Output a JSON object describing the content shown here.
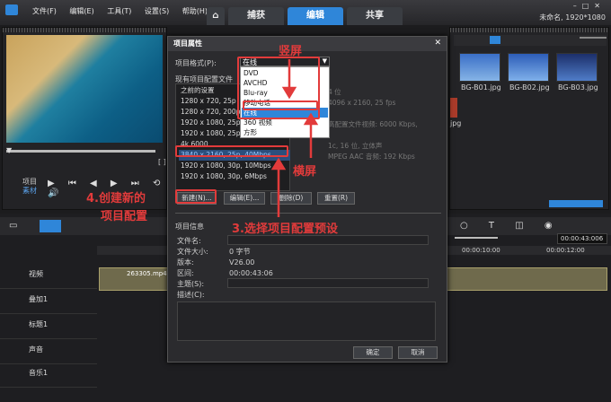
{
  "app": {
    "tabs": [
      "捕获",
      "编辑",
      "共享"
    ],
    "active_tab": "编辑",
    "status_right": "未命名, 1920*1080"
  },
  "menu": [
    "文件(F)",
    "编辑(E)",
    "工具(T)",
    "设置(S)",
    "帮助(H)"
  ],
  "library": {
    "thumbs": [
      "BG-B01.jpg",
      "BG-B02.jpg",
      "BG-B03.jpg"
    ],
    "extra_label": "jpg"
  },
  "dialog": {
    "title": "项目属性",
    "format_label": "项目格式(P):",
    "format_value": "在线",
    "format_options": [
      "DVD",
      "AVCHD",
      "Blu-ray",
      "移动电话",
      "在线",
      "360 视频",
      "方形"
    ],
    "format_selected": "在线",
    "profiles_label": "现有项目配置文件",
    "profiles": [
      "之前的设置",
      "1280 x 720, 25p",
      "1280 x 720, 200p",
      "1920 x 1080, 25p",
      "1920 x 1080, 25p",
      "4k 6000",
      "3840 x 2160, 25p, 40Mbps",
      "1920 x 1080, 30p, 10Mbps",
      "1920 x 1080, 30p, 6Mbps"
    ],
    "profile_selected_index": 6,
    "buttons": {
      "new": "新建(N)...",
      "edit": "编辑(E)...",
      "delete": "删除(D)",
      "reset": "重置(R)"
    },
    "info_header": "项目信息",
    "info": [
      {
        "k": "文件名:",
        "v": ""
      },
      {
        "k": "文件大小:",
        "v": "0 字节"
      },
      {
        "k": "版本:",
        "v": "V26.00"
      },
      {
        "k": "区间:",
        "v": "00:00:43:06"
      },
      {
        "k": "主题(S):",
        "v": ""
      },
      {
        "k": "描述(C):",
        "v": ""
      }
    ],
    "ok": "确定",
    "cancel": "取消",
    "behind_text": [
      "4 位",
      "4096 x 2160, 25 fps",
      "高配置文件视频: 6000 Kbps,",
      "1c, 16 位, 立体声",
      "MPEG AAC 音频: 192 Kbps"
    ]
  },
  "annotations": {
    "portrait": "竖屏",
    "landscape": "横屏",
    "step3": "3.选择项目配置预设",
    "step4a": "4.创建新的",
    "step4b": "项目配置"
  },
  "player": {
    "labels": [
      "项目",
      "素材"
    ],
    "timecode": "00:00:43:006"
  },
  "timeline": {
    "ruler": [
      "00:00:10:00",
      "00:00:12:00"
    ],
    "tracks": [
      "视频",
      "叠加1",
      "标题1",
      "声音",
      "音乐1"
    ],
    "clip": "263305.mp4"
  },
  "colors": {
    "accent": "#2f86d9",
    "annotation": "#e23b3b"
  }
}
